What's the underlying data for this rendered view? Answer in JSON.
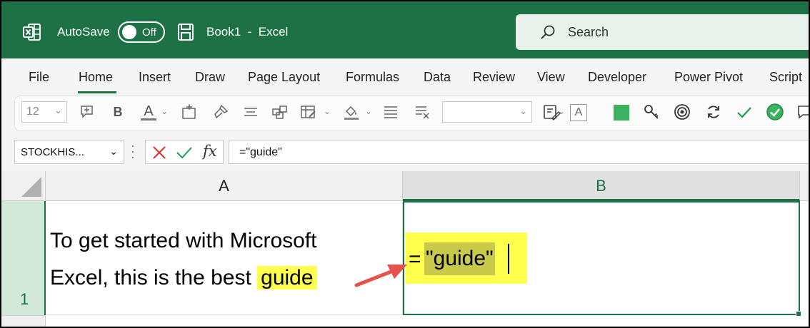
{
  "titlebar": {
    "autosave_label": "AutoSave",
    "autosave_state": "Off",
    "doc_title": "Book1  -  Excel",
    "search_placeholder": "Search"
  },
  "menu": {
    "items": [
      "File",
      "Home",
      "Insert",
      "Draw",
      "Page Layout",
      "Formulas",
      "Data",
      "Review",
      "View",
      "Developer",
      "Power Pivot",
      "Script"
    ],
    "active": "Home"
  },
  "ribbon": {
    "font_size": "12",
    "bold_label": "B",
    "font_color_label": "A",
    "text_box_label": "A"
  },
  "formula_bar": {
    "name_box": "STOCKHIS...",
    "fx_label": "fx",
    "formula": "=\"guide\""
  },
  "grid": {
    "columns": [
      "A",
      "B"
    ],
    "rows": [
      "1"
    ],
    "cellA_line1": "To get started with Microsoft",
    "cellA_line2_prefix": "Excel, this is the best ",
    "cellA_highlight": "guide",
    "cellB_eq": "=",
    "cellB_selected": "\"guide\""
  },
  "colors": {
    "accent": "#1e7145",
    "highlight": "#ffff4d",
    "arrow": "#e8524a"
  }
}
